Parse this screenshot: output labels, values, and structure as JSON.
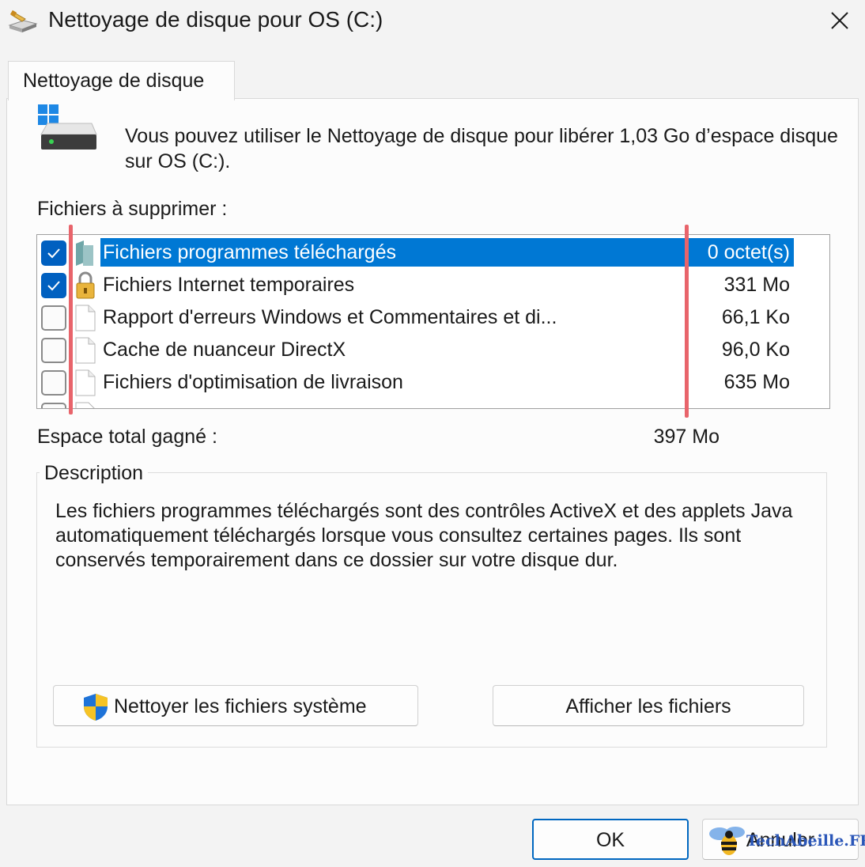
{
  "window": {
    "title": "Nettoyage de disque pour OS (C:)"
  },
  "tabs": [
    {
      "label": "Nettoyage de disque"
    }
  ],
  "intro_text": "Vous pouvez utiliser le Nettoyage de disque pour libérer 1,03 Go d’espace disque sur OS (C:).",
  "files_label": "Fichiers à supprimer :",
  "files": [
    {
      "name": "Fichiers programmes téléchargés",
      "size": "0 octet(s)",
      "checked": true,
      "selected": true,
      "icon": "folder-icon"
    },
    {
      "name": "Fichiers Internet temporaires",
      "size": "331 Mo",
      "checked": true,
      "selected": false,
      "icon": "lock-icon"
    },
    {
      "name": "Rapport d'erreurs Windows et Commentaires et di...",
      "size": "66,1 Ko",
      "checked": false,
      "selected": false,
      "icon": "document-icon"
    },
    {
      "name": "Cache de nuanceur DirectX",
      "size": "96,0 Ko",
      "checked": false,
      "selected": false,
      "icon": "document-icon"
    },
    {
      "name": "Fichiers d'optimisation de livraison",
      "size": "635 Mo",
      "checked": false,
      "selected": false,
      "icon": "document-icon"
    }
  ],
  "total": {
    "label": "Espace total gagné :",
    "value": "397 Mo"
  },
  "description": {
    "legend": "Description",
    "text": "Les fichiers programmes téléchargés sont des contrôles ActiveX et des applets Java automatiquement téléchargés lorsque vous consultez certaines pages. Ils sont conservés temporairement dans ce dossier sur votre disque dur."
  },
  "buttons": {
    "clean_system": "Nettoyer les fichiers système",
    "view_files": "Afficher les fichiers",
    "ok": "OK",
    "cancel": "Annuler"
  },
  "watermark": "TechAbeille.FR",
  "colors": {
    "accent": "#0078d4",
    "checkbox_checked": "#0060c0",
    "annotation_marker": "#e8646b"
  }
}
